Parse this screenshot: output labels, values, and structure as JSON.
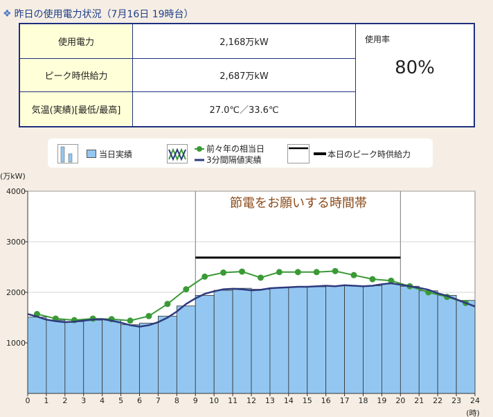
{
  "header": {
    "title": "昨日の使用電力状況（7月16日 19時台）"
  },
  "table": {
    "rows": [
      {
        "label": "使用電力",
        "value": "2,168万kW"
      },
      {
        "label": "ピーク時供給力",
        "value": "2,687万kW"
      },
      {
        "label": "気温(実績)[最低/最高]",
        "value": "27.0℃／33.6℃"
      }
    ],
    "rate_label": "使用率",
    "rate_value": "80%"
  },
  "legend": {
    "bar": "当日実績",
    "prev": "前々年の相当日",
    "interval": "3分間隔値実績",
    "peak": "本日のピーク時供給力"
  },
  "chart_data": {
    "type": "bar",
    "ylabel": "(万kW)",
    "xlabel": "(時)",
    "ylim": [
      0,
      4000
    ],
    "yticks": [
      1000,
      2000,
      3000,
      4000
    ],
    "xticks": [
      0,
      1,
      2,
      3,
      4,
      5,
      6,
      7,
      8,
      9,
      10,
      11,
      12,
      13,
      14,
      15,
      16,
      17,
      18,
      19,
      20,
      21,
      22,
      23,
      24
    ],
    "annotation": "節電をお願いする時間帯",
    "highlight_range": [
      9,
      20
    ],
    "peak_supply": {
      "value": 2687,
      "range": [
        9,
        20
      ]
    },
    "series": [
      {
        "name": "当日実績",
        "type": "bar",
        "values": [
          1510,
          1450,
          1420,
          1450,
          1460,
          1360,
          1390,
          1530,
          1730,
          1940,
          2040,
          2080,
          2060,
          2090,
          2110,
          2110,
          2130,
          2130,
          2130,
          2168,
          2120,
          2030,
          1940,
          1840
        ]
      },
      {
        "name": "前々年の相当日",
        "type": "line",
        "values": [
          1570,
          1480,
          1450,
          1480,
          1470,
          1440,
          1530,
          1770,
          2060,
          2310,
          2390,
          2410,
          2290,
          2400,
          2400,
          2400,
          2420,
          2340,
          2260,
          2230,
          2120,
          2000,
          1910,
          1790
        ]
      },
      {
        "name": "3分間隔値実績",
        "type": "line",
        "x": [
          0,
          0.5,
          1,
          1.5,
          2,
          2.5,
          3,
          3.5,
          4,
          4.5,
          5,
          5.5,
          6,
          6.5,
          7,
          7.5,
          8,
          8.5,
          9,
          9.5,
          10,
          10.5,
          11,
          11.5,
          12,
          12.5,
          13,
          13.5,
          14,
          14.5,
          15,
          15.5,
          16,
          16.5,
          17,
          17.5,
          18,
          18.5,
          19,
          19.5,
          20,
          20.5,
          21,
          21.5,
          22,
          22.5,
          23,
          23.5,
          24
        ],
        "values": [
          1570,
          1520,
          1460,
          1430,
          1410,
          1420,
          1440,
          1460,
          1470,
          1440,
          1400,
          1350,
          1320,
          1350,
          1410,
          1500,
          1620,
          1770,
          1880,
          1970,
          2020,
          2060,
          2070,
          2060,
          2040,
          2050,
          2080,
          2090,
          2100,
          2110,
          2110,
          2120,
          2130,
          2120,
          2140,
          2130,
          2120,
          2130,
          2160,
          2180,
          2150,
          2120,
          2090,
          2050,
          1980,
          1930,
          1860,
          1790,
          1720
        ]
      }
    ],
    "colors": {
      "bar": "#93c7f1",
      "prev": "#3a9a35",
      "interval": "#2f3a7c",
      "peak": "#000000",
      "annotation": "#8b4a1a"
    }
  }
}
